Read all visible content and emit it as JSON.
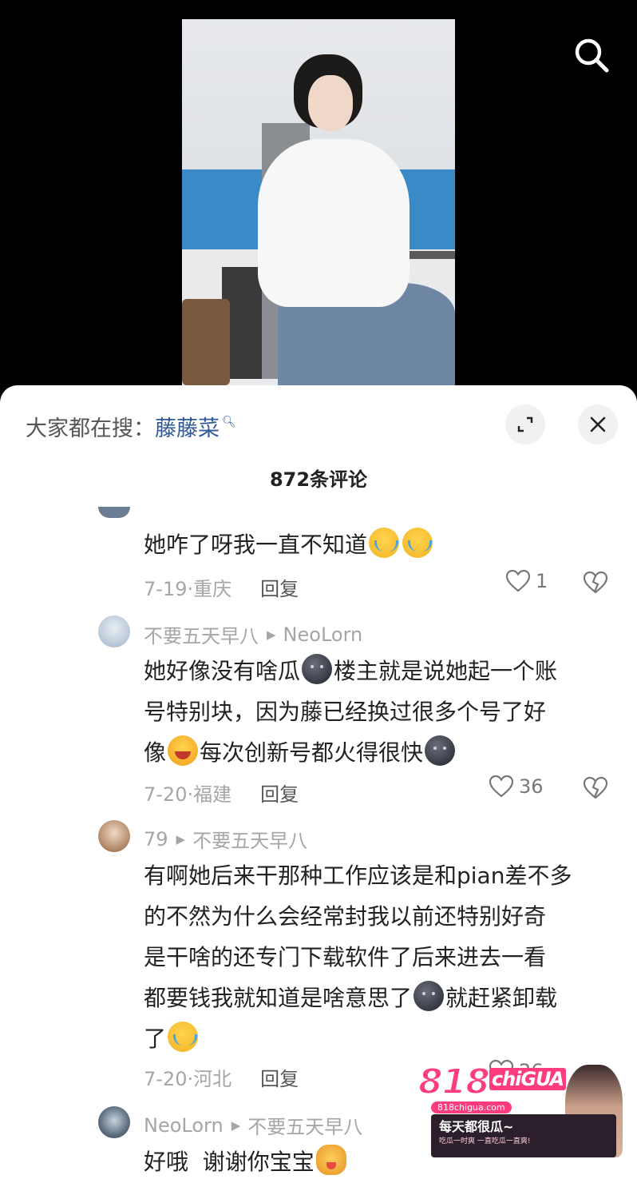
{
  "video": {
    "search_icon": "search-icon"
  },
  "sheet": {
    "search_hint": {
      "prefix": "大家都在搜：",
      "keyword": "藤藤菜",
      "icon": "search-small-icon"
    },
    "expand_icon": "expand-icon",
    "close_icon": "close-icon",
    "comment_count": "872条评论"
  },
  "comments": [
    {
      "text_before": "她咋了呀我一直不知道",
      "emojis": [
        "cry",
        "cry"
      ],
      "date_location": "7-19·重庆",
      "reply_label": "回复",
      "likes": "1"
    },
    {
      "author": "不要五天早八",
      "reply_to": "NeoLorn",
      "line1_a": "她好像没有啥瓜",
      "line1_b": "楼主就是说她起一个账",
      "line2": "号特别块，因为藤已经换过很多个号了好",
      "line3_a": "像",
      "line3_b": "每次创新号都火得很快",
      "date_location": "7-20·福建",
      "reply_label": "回复",
      "likes": "36"
    },
    {
      "author": "79",
      "reply_to": "不要五天早八",
      "line1": "有啊她后来干那种工作应该是和pian差不多",
      "line2": "的不然为什么会经常封我以前还特别好奇",
      "line3": "是干啥的还专门下载软件了后来进去一看",
      "line4_a": "都要钱我就知道是啥意思了",
      "line4_b": "就赶紧卸载",
      "line5": "了",
      "date_location": "7-20·河北",
      "reply_label": "回复",
      "likes": "26"
    },
    {
      "author": "NeoLorn",
      "reply_to": "不要五天早八",
      "text": "好哦  谢谢你宝宝"
    }
  ],
  "watermark": {
    "logo_main": "818",
    "logo_sub": "chiGUA",
    "url": "818chigua.com",
    "slogan": "每天都很瓜~",
    "subline": "吃瓜一时爽 一直吃瓜一直爽!"
  },
  "colors": {
    "link_blue": "#2f5a95",
    "muted_gray": "#a6a6a6",
    "watermark_pink": "#ff3c7d"
  }
}
